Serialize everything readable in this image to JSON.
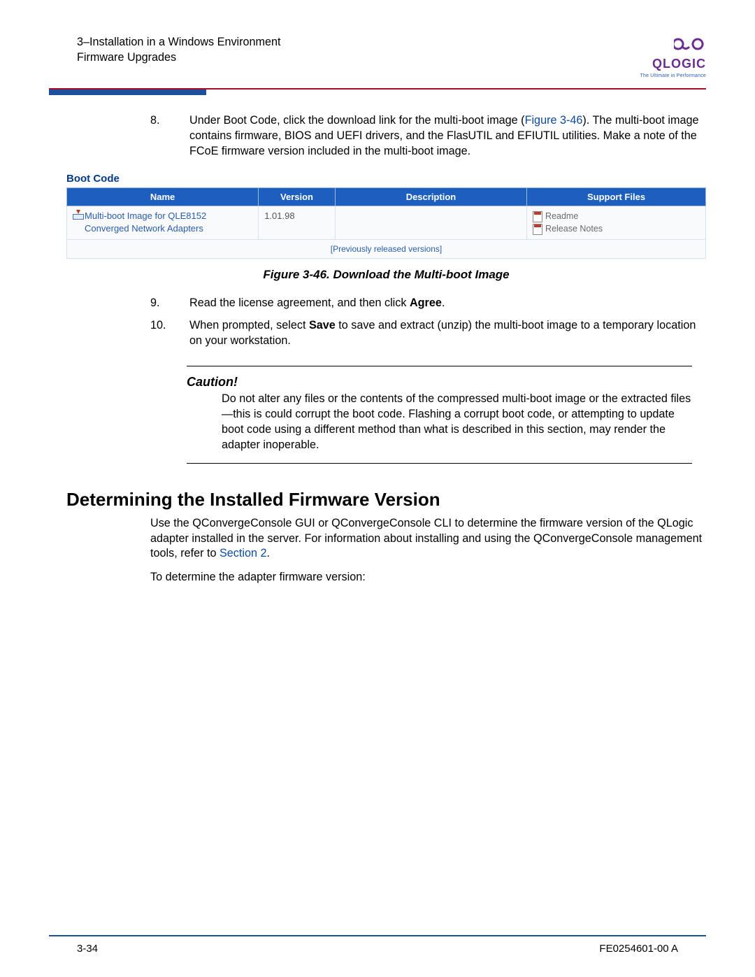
{
  "header": {
    "line1": "3–Installation in a Windows Environment",
    "line2": "Firmware Upgrades"
  },
  "logo": {
    "name": "QLOGIC",
    "tagline": "The Ultimate in Performance"
  },
  "step8": {
    "num": "8.",
    "pre": "Under Boot Code, click the download link for the multi-boot image (",
    "ref": "Figure 3-46",
    "post": "). The multi-boot image contains firmware, BIOS and UEFI drivers, and the FlasUTIL and EFIUTIL utilities. Make a note of the FCoE firmware version included in the multi-boot image."
  },
  "figure": {
    "title": "Boot Code",
    "cols": {
      "name": "Name",
      "version": "Version",
      "desc": "Description",
      "support": "Support Files"
    },
    "row": {
      "name": "Multi-boot Image for QLE8152 Converged Network Adapters",
      "version": "1.01.98",
      "desc": "",
      "support1": "Readme",
      "support2": "Release Notes"
    },
    "prev": "[Previously released versions]",
    "caption": "Figure 3-46. Download the Multi-boot Image"
  },
  "step9": {
    "num": "9.",
    "pre": "Read the license agreement, and then click ",
    "bold": "Agree",
    "post": "."
  },
  "step10": {
    "num": "10.",
    "pre": "When prompted, select ",
    "bold": "Save",
    "post": " to save and extract (unzip) the multi-boot image to a temporary location on your workstation."
  },
  "caution": {
    "title": "Caution!",
    "body": "Do not alter any files or the contents of the compressed multi-boot image or the extracted files—this is could corrupt the boot code. Flashing a corrupt boot code, or attempting to update boot code using a different method than what is described in this section, may render the adapter inoperable."
  },
  "section": {
    "heading": "Determining the Installed Firmware Version",
    "p1a": "Use the QConvergeConsole GUI or QConvergeConsole CLI to determine the firmware version of the QLogic adapter installed in the server. For information about installing and using the QConvergeConsole management tools, refer to ",
    "p1ref": "Section 2",
    "p1b": ".",
    "p2": "To determine the adapter firmware version:"
  },
  "footer": {
    "left": "3-34",
    "right": "FE0254601-00 A"
  }
}
